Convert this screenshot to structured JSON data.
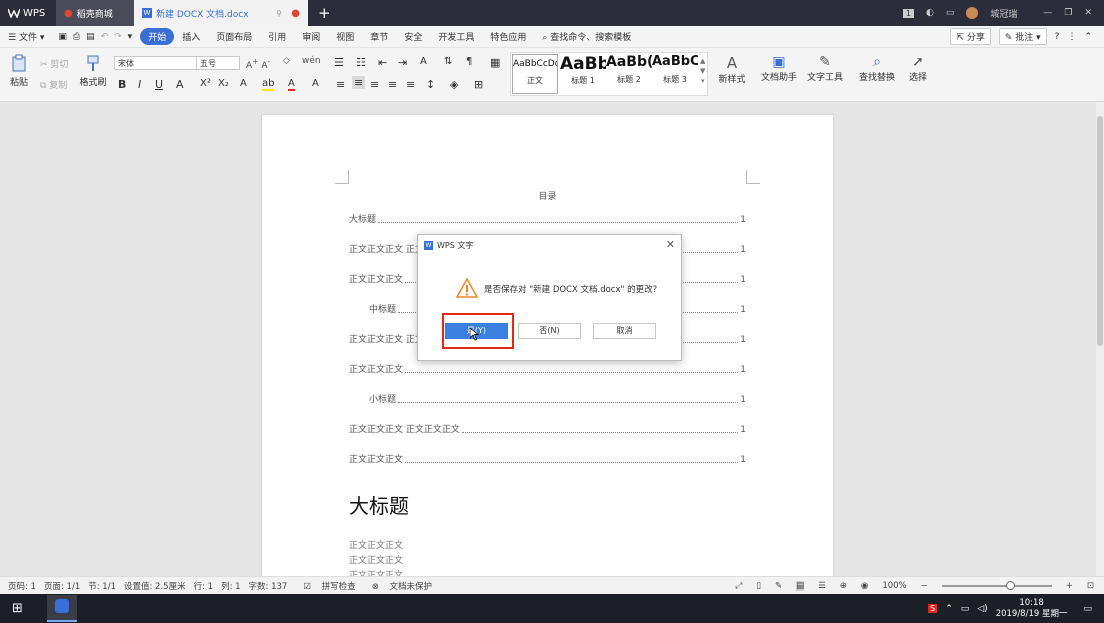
{
  "titlebar": {
    "app_logo": "WPS",
    "tabs": [
      {
        "label": "稻壳商城"
      },
      {
        "label": "新建 DOCX 文档.docx"
      }
    ],
    "badge": "1",
    "user_name": "城冠瑞"
  },
  "menubar": {
    "file": "文件",
    "items": [
      "开始",
      "插入",
      "页面布局",
      "引用",
      "审阅",
      "视图",
      "章节",
      "安全",
      "开发工具",
      "特色应用"
    ],
    "search": "查找命令、搜索模板",
    "share": "分享",
    "comment": "批注"
  },
  "ribbon": {
    "paste": "粘贴",
    "cut": "剪切",
    "copy": "复制",
    "format_painter": "格式刷",
    "font_name": "宋体",
    "font_size": "五号",
    "styles": [
      {
        "sample": "AaBbCcDd",
        "name": "正文"
      },
      {
        "sample": "AaBb",
        "name": "标题 1"
      },
      {
        "sample": "AaBb(",
        "name": "标题 2"
      },
      {
        "sample": "AaBbC",
        "name": "标题 3"
      }
    ],
    "new_style": "新样式",
    "doc_assistant": "文档助手",
    "text_tools": "文字工具",
    "find_replace": "查找替换",
    "select": "选择"
  },
  "document": {
    "toc_title": "目录",
    "toc": [
      {
        "text": "大标题",
        "page": "1",
        "indent": 0
      },
      {
        "text": "正文正文正文  正文正文正文",
        "page": "1",
        "indent": 0
      },
      {
        "text": "正文正文正文",
        "page": "1",
        "indent": 0
      },
      {
        "text": "中标题",
        "page": "1",
        "indent": 1
      },
      {
        "text": "正文正文正文  正文正文正文",
        "page": "1",
        "indent": 0
      },
      {
        "text": "正文正文正文",
        "page": "1",
        "indent": 0
      },
      {
        "text": "小标题",
        "page": "1",
        "indent": 1
      },
      {
        "text": "正文正文正文  正文正文正文",
        "page": "1",
        "indent": 0
      },
      {
        "text": "正文正文正文",
        "page": "1",
        "indent": 0
      }
    ],
    "heading": "大标题",
    "body_lines": [
      "正文正文正文",
      "正文正文正文",
      "正文正文正文"
    ]
  },
  "dialog": {
    "title": "WPS 文字",
    "message": "是否保存对 \"新建 DOCX 文档.docx\" 的更改?",
    "yes": "是(Y)",
    "no": "否(N)",
    "cancel": "取消"
  },
  "statusbar": {
    "page_num": "页码: 1",
    "pages": "页面: 1/1",
    "section": "节: 1/1",
    "setting": "设置值: 2.5厘米",
    "row": "行: 1",
    "col": "列: 1",
    "word_count": "字数: 137",
    "spell_check": "拼写检查",
    "doc_protect": "文档未保护",
    "zoom": "100%",
    "zoom_level": 0.55
  },
  "taskbar": {
    "time": "10:18",
    "date": "2019/8/19 星期一"
  },
  "colors": {
    "accent": "#3a6fd8",
    "highlight": "#e0281e",
    "titlebar": "#2b2d3a"
  }
}
